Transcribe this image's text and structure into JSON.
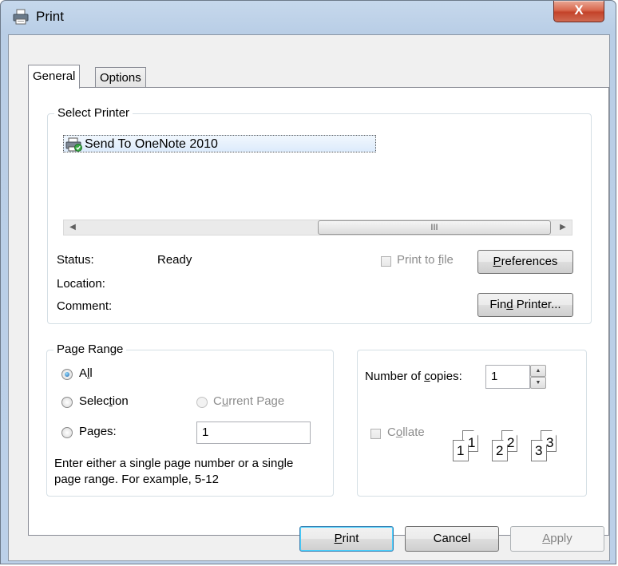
{
  "window": {
    "title": "Print",
    "close_label": "X"
  },
  "tabs": [
    {
      "label": "General"
    },
    {
      "label": "Options"
    }
  ],
  "select_printer": {
    "label": "Select Printer",
    "printers": [
      {
        "name": "Send To OneNote 2010"
      }
    ],
    "scroll_thumb_grip": "III"
  },
  "printer_info": {
    "status_label": "Status:",
    "status_value": "Ready",
    "location_label": "Location:",
    "location_value": "",
    "comment_label": "Comment:",
    "comment_value": ""
  },
  "print_to_file": {
    "label_pre": "Print to ",
    "label_key": "f",
    "label_post": "ile",
    "checked": false,
    "enabled": false
  },
  "preferences_button": {
    "pre": "",
    "key": "P",
    "post": "references"
  },
  "find_printer_button": {
    "pre": "Fin",
    "key": "d",
    "post": " Printer..."
  },
  "page_range": {
    "label": "Page Range",
    "all": {
      "pre": "A",
      "key": "l",
      "post": "l",
      "checked": true
    },
    "selection": {
      "pre": "Selec",
      "key": "t",
      "post": "ion",
      "checked": false
    },
    "current_page": {
      "pre": "C",
      "key": "u",
      "post": "rrent Page",
      "checked": false,
      "enabled": false
    },
    "pages": {
      "pre": "Pa",
      "key": "g",
      "post": "es:",
      "checked": false,
      "value": "1"
    },
    "help_text_line1": "Enter either a single page number or a single",
    "help_text_line2": "page range.  For example, 5-12"
  },
  "copies": {
    "label_pre": "Number of ",
    "label_key": "c",
    "label_post": "opies:",
    "value": "1",
    "collate": {
      "pre": "C",
      "key": "o",
      "post": "llate",
      "checked": false,
      "enabled": false
    },
    "collate_pages": [
      "1",
      "1",
      "2",
      "2",
      "3",
      "3"
    ]
  },
  "footer": {
    "print": {
      "pre": "",
      "key": "P",
      "post": "rint"
    },
    "cancel": {
      "label": "Cancel"
    },
    "apply": {
      "pre": "",
      "key": "A",
      "post": "pply",
      "enabled": false
    }
  },
  "colors": {
    "title_bar": "#bcd0e8",
    "close_button": "#c4432a",
    "default_button_focus": "#3c7fb1",
    "printer_selection": "#dcebfc"
  }
}
